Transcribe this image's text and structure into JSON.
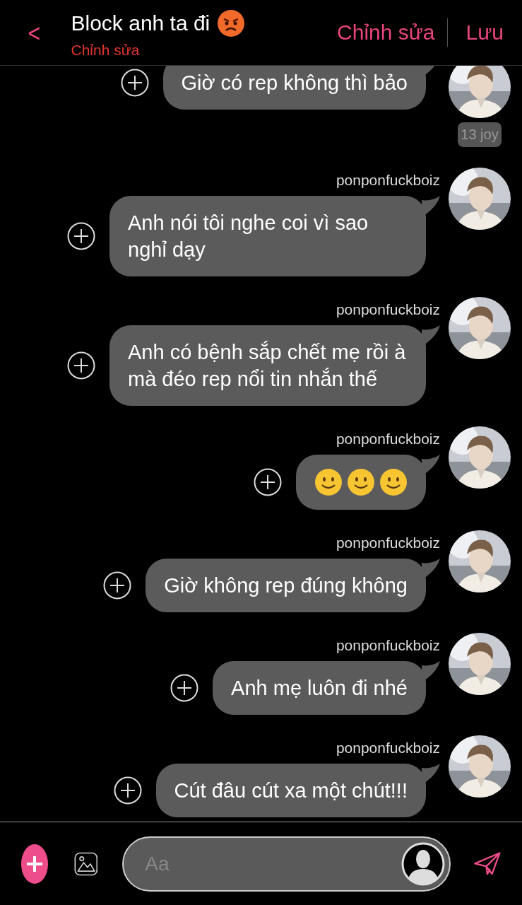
{
  "header": {
    "back": "<",
    "title": "Block anh ta đi",
    "subtitle": "Chỉnh sửa",
    "actions": [
      "Chỉnh sửa",
      "Lưu"
    ]
  },
  "messages": [
    {
      "kind": "text",
      "text": "Giờ có rep không thì bảo",
      "badge": "13 joy"
    },
    {
      "kind": "text",
      "sender": "ponponfuckboiz",
      "text": "Anh nói tôi nghe coi vì sao nghỉ dạy"
    },
    {
      "kind": "text",
      "sender": "ponponfuckboiz",
      "text": "Anh có bệnh sắp chết mẹ rồi à mà đéo rep nổi tin nhắn thế"
    },
    {
      "kind": "emoji",
      "sender": "ponponfuckboiz",
      "emojis": [
        {
          "kind": "smile"
        },
        {
          "kind": "smile"
        },
        {
          "kind": "smile"
        }
      ]
    },
    {
      "kind": "text",
      "sender": "ponponfuckboiz",
      "text": "Giờ không rep đúng không"
    },
    {
      "kind": "text",
      "sender": "ponponfuckboiz",
      "text": "Anh mẹ luôn đi nhé"
    },
    {
      "kind": "text",
      "sender": "ponponfuckboiz",
      "text": "Cút đâu cút xa một chút!!!"
    }
  ],
  "composer": {
    "placeholder": "Aa"
  }
}
